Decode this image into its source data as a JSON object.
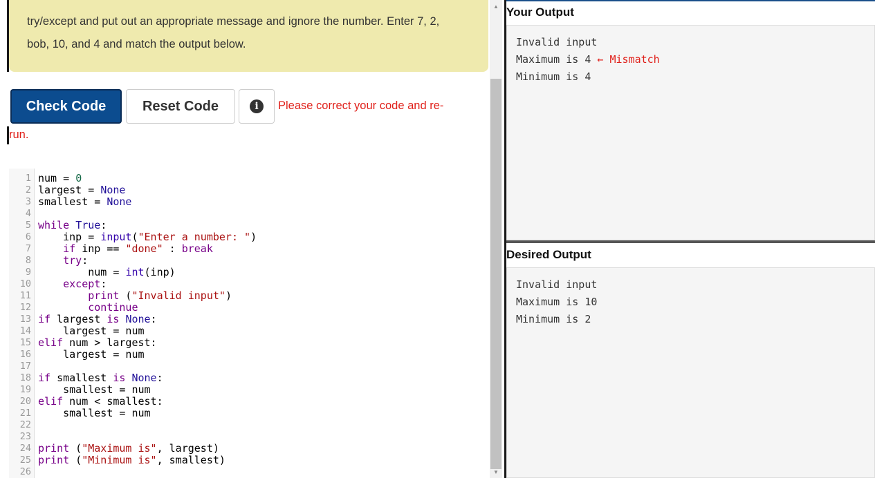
{
  "instructions": {
    "line1": "try/except and put out an appropriate message and ignore the number. Enter 7, 2,",
    "line2": "bob, 10, and 4 and match the output below."
  },
  "buttons": {
    "check_label": "Check Code",
    "reset_label": "Reset Code",
    "info_glyph": "i"
  },
  "feedback": {
    "line1": "Please correct your code and re-",
    "line2": "run."
  },
  "code": {
    "line_numbers": [
      "1",
      "2",
      "3",
      "4",
      "5",
      "6",
      "7",
      "8",
      "9",
      "10",
      "11",
      "12",
      "13",
      "14",
      "15",
      "16",
      "17",
      "18",
      "19",
      "20",
      "21",
      "22",
      "23",
      "24",
      "25",
      "26"
    ]
  },
  "your_output": {
    "title": "Your Output",
    "lines": [
      "Invalid input",
      "Maximum is 4",
      "Minimum is 4"
    ],
    "mismatch_label": "← Mismatch"
  },
  "desired_output": {
    "title": "Desired Output",
    "lines": [
      "Invalid input",
      "Maximum is 10",
      "Minimum is 2"
    ]
  },
  "colors": {
    "check_button": "#0c4c8f",
    "instructions_bg": "#efeaae",
    "error_text": "#e0201a",
    "keyword": "#770088",
    "string": "#aa1111"
  }
}
